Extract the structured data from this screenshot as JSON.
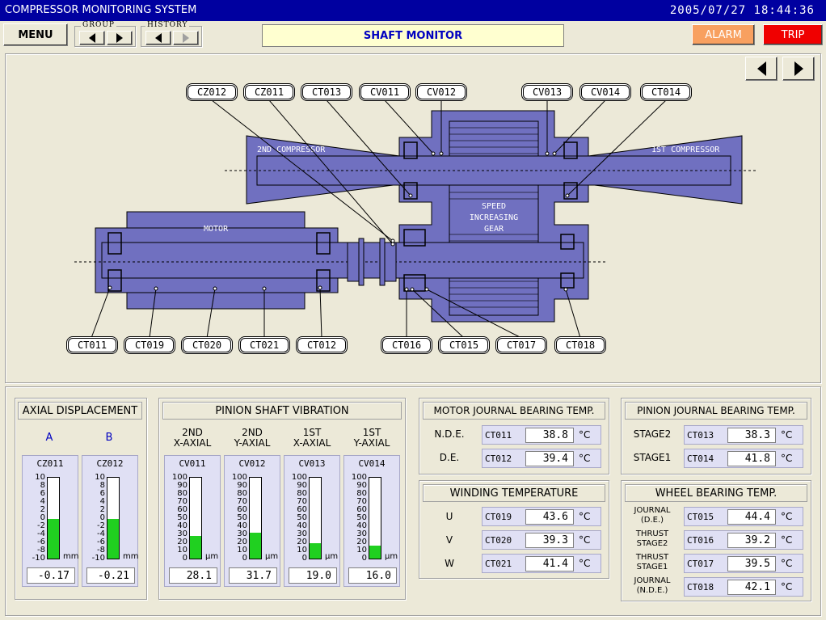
{
  "header": {
    "title": "COMPRESSOR MONITORING SYSTEM",
    "datetime": "2005/07/27  18:44:36"
  },
  "toolbar": {
    "menu_label": "MENU",
    "group_label": "GROUP",
    "history_label": "HISTORY",
    "screen_title": "SHAFT MONITOR",
    "alarm_label": "ALARM",
    "trip_label": "TRIP"
  },
  "colors": {
    "alarm": "#f8a060",
    "trip": "#f00000",
    "machine": "#7070c0",
    "fill": "#20d020"
  },
  "diagram": {
    "labels": {
      "second_compressor": "2ND COMPRESSOR",
      "first_compressor": "1ST COMPRESSOR",
      "motor": "MOTOR",
      "gear": [
        "SPEED",
        "INCREASING",
        "GEAR"
      ]
    },
    "top_tags": [
      "CZ012",
      "CZ011",
      "CT013",
      "CV011",
      "CV012",
      "CV013",
      "CV014",
      "CT014"
    ],
    "bottom_tags": [
      "CT011",
      "CT019",
      "CT020",
      "CT021",
      "CT012",
      "CT016",
      "CT015",
      "CT017",
      "CT018"
    ]
  },
  "axial": {
    "title": "AXIAL DISPLACEMENT",
    "unit": "mm",
    "scale": [
      "10",
      "8",
      "6",
      "4",
      "2",
      "0",
      "-2",
      "-4",
      "-6",
      "-8",
      "-10"
    ],
    "gauges": [
      {
        "label": "A",
        "tag": "CZ011",
        "value": "-0.17",
        "level": -0.17
      },
      {
        "label": "B",
        "tag": "CZ012",
        "value": "-0.21",
        "level": -0.21
      }
    ]
  },
  "vibration": {
    "title": "PINION SHAFT VIBRATION",
    "unit": "μm",
    "scale": [
      "100",
      "90",
      "80",
      "70",
      "60",
      "50",
      "40",
      "30",
      "20",
      "10",
      "0"
    ],
    "gauges": [
      {
        "label1": "2ND",
        "label2": "X-AXIAL",
        "tag": "CV011",
        "value": "28.1",
        "level": 28.1
      },
      {
        "label1": "2ND",
        "label2": "Y-AXIAL",
        "tag": "CV012",
        "value": "31.7",
        "level": 31.7
      },
      {
        "label1": "1ST",
        "label2": "X-AXIAL",
        "tag": "CV013",
        "value": "19.0",
        "level": 19.0
      },
      {
        "label1": "1ST",
        "label2": "Y-AXIAL",
        "tag": "CV014",
        "value": "16.0",
        "level": 16.0
      }
    ]
  },
  "motor_bearing": {
    "title": "MOTOR JOURNAL BEARING TEMP.",
    "unit": "°C",
    "rows": [
      {
        "label": "N.D.E.",
        "tag": "CT011",
        "value": "38.8"
      },
      {
        "label": "D.E.",
        "tag": "CT012",
        "value": "39.4"
      }
    ]
  },
  "winding": {
    "title": "WINDING TEMPERATURE",
    "unit": "°C",
    "rows": [
      {
        "label": "U",
        "tag": "CT019",
        "value": "43.6"
      },
      {
        "label": "V",
        "tag": "CT020",
        "value": "39.3"
      },
      {
        "label": "W",
        "tag": "CT021",
        "value": "41.4"
      }
    ]
  },
  "pinion_bearing": {
    "title": "PINION JOURNAL BEARING TEMP.",
    "unit": "°C",
    "rows": [
      {
        "label": "STAGE2",
        "tag": "CT013",
        "value": "38.3"
      },
      {
        "label": "STAGE1",
        "tag": "CT014",
        "value": "41.8"
      }
    ]
  },
  "wheel_bearing": {
    "title": "WHEEL BEARING TEMP.",
    "unit": "°C",
    "rows": [
      {
        "label1": "JOURNAL",
        "label2": "(D.E.)",
        "tag": "CT015",
        "value": "44.4"
      },
      {
        "label1": "THRUST",
        "label2": "STAGE2",
        "tag": "CT016",
        "value": "39.2"
      },
      {
        "label1": "THRUST",
        "label2": "STAGE1",
        "tag": "CT017",
        "value": "39.5"
      },
      {
        "label1": "JOURNAL",
        "label2": "(N.D.E.)",
        "tag": "CT018",
        "value": "42.1"
      }
    ]
  }
}
